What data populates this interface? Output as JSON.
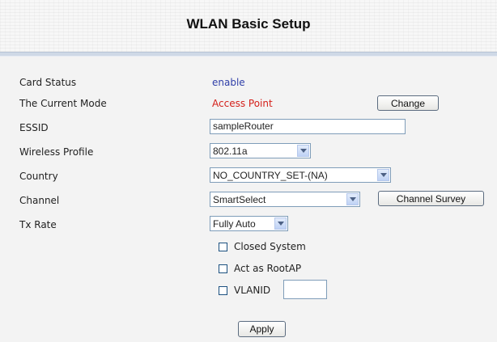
{
  "header": {
    "title": "WLAN Basic Setup"
  },
  "card_status": {
    "label": "Card Status",
    "value": "enable"
  },
  "current_mode": {
    "label": "The Current Mode",
    "value": "Access Point",
    "button": "Change"
  },
  "essid": {
    "label": "ESSID",
    "value": "sampleRouter"
  },
  "wireless_profile": {
    "label": "Wireless Profile",
    "selected": "802.11a"
  },
  "country": {
    "label": "Country",
    "selected": "NO_COUNTRY_SET-(NA)"
  },
  "channel": {
    "label": "Channel",
    "selected": "SmartSelect",
    "survey_button": "Channel Survey"
  },
  "tx_rate": {
    "label": "Tx Rate",
    "selected": "Fully Auto"
  },
  "options": {
    "closed_system": {
      "label": "Closed System",
      "checked": false
    },
    "act_as_rootap": {
      "label": "Act as RootAP",
      "checked": false
    },
    "vlanid": {
      "label": "VLANID",
      "checked": false,
      "value": ""
    }
  },
  "apply_button": "Apply",
  "colors": {
    "status_value": "#2f3fa8",
    "mode_value": "#d4201a",
    "input_border": "#7f9db9"
  }
}
